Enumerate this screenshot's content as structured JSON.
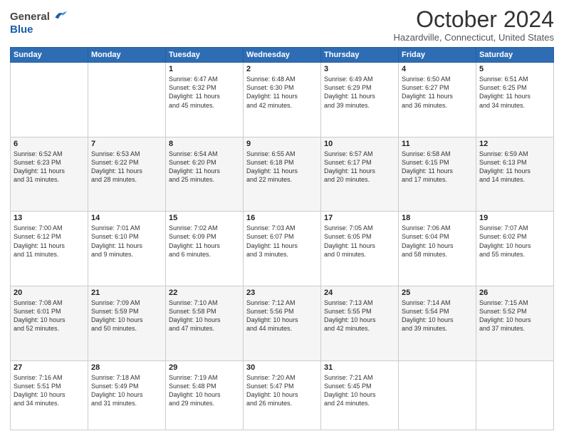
{
  "header": {
    "logo_general": "General",
    "logo_blue": "Blue",
    "title": "October 2024",
    "location": "Hazardville, Connecticut, United States"
  },
  "days_of_week": [
    "Sunday",
    "Monday",
    "Tuesday",
    "Wednesday",
    "Thursday",
    "Friday",
    "Saturday"
  ],
  "rows": [
    [
      {
        "num": "",
        "lines": []
      },
      {
        "num": "",
        "lines": []
      },
      {
        "num": "1",
        "lines": [
          "Sunrise: 6:47 AM",
          "Sunset: 6:32 PM",
          "Daylight: 11 hours",
          "and 45 minutes."
        ]
      },
      {
        "num": "2",
        "lines": [
          "Sunrise: 6:48 AM",
          "Sunset: 6:30 PM",
          "Daylight: 11 hours",
          "and 42 minutes."
        ]
      },
      {
        "num": "3",
        "lines": [
          "Sunrise: 6:49 AM",
          "Sunset: 6:29 PM",
          "Daylight: 11 hours",
          "and 39 minutes."
        ]
      },
      {
        "num": "4",
        "lines": [
          "Sunrise: 6:50 AM",
          "Sunset: 6:27 PM",
          "Daylight: 11 hours",
          "and 36 minutes."
        ]
      },
      {
        "num": "5",
        "lines": [
          "Sunrise: 6:51 AM",
          "Sunset: 6:25 PM",
          "Daylight: 11 hours",
          "and 34 minutes."
        ]
      }
    ],
    [
      {
        "num": "6",
        "lines": [
          "Sunrise: 6:52 AM",
          "Sunset: 6:23 PM",
          "Daylight: 11 hours",
          "and 31 minutes."
        ]
      },
      {
        "num": "7",
        "lines": [
          "Sunrise: 6:53 AM",
          "Sunset: 6:22 PM",
          "Daylight: 11 hours",
          "and 28 minutes."
        ]
      },
      {
        "num": "8",
        "lines": [
          "Sunrise: 6:54 AM",
          "Sunset: 6:20 PM",
          "Daylight: 11 hours",
          "and 25 minutes."
        ]
      },
      {
        "num": "9",
        "lines": [
          "Sunrise: 6:55 AM",
          "Sunset: 6:18 PM",
          "Daylight: 11 hours",
          "and 22 minutes."
        ]
      },
      {
        "num": "10",
        "lines": [
          "Sunrise: 6:57 AM",
          "Sunset: 6:17 PM",
          "Daylight: 11 hours",
          "and 20 minutes."
        ]
      },
      {
        "num": "11",
        "lines": [
          "Sunrise: 6:58 AM",
          "Sunset: 6:15 PM",
          "Daylight: 11 hours",
          "and 17 minutes."
        ]
      },
      {
        "num": "12",
        "lines": [
          "Sunrise: 6:59 AM",
          "Sunset: 6:13 PM",
          "Daylight: 11 hours",
          "and 14 minutes."
        ]
      }
    ],
    [
      {
        "num": "13",
        "lines": [
          "Sunrise: 7:00 AM",
          "Sunset: 6:12 PM",
          "Daylight: 11 hours",
          "and 11 minutes."
        ]
      },
      {
        "num": "14",
        "lines": [
          "Sunrise: 7:01 AM",
          "Sunset: 6:10 PM",
          "Daylight: 11 hours",
          "and 9 minutes."
        ]
      },
      {
        "num": "15",
        "lines": [
          "Sunrise: 7:02 AM",
          "Sunset: 6:09 PM",
          "Daylight: 11 hours",
          "and 6 minutes."
        ]
      },
      {
        "num": "16",
        "lines": [
          "Sunrise: 7:03 AM",
          "Sunset: 6:07 PM",
          "Daylight: 11 hours",
          "and 3 minutes."
        ]
      },
      {
        "num": "17",
        "lines": [
          "Sunrise: 7:05 AM",
          "Sunset: 6:05 PM",
          "Daylight: 11 hours",
          "and 0 minutes."
        ]
      },
      {
        "num": "18",
        "lines": [
          "Sunrise: 7:06 AM",
          "Sunset: 6:04 PM",
          "Daylight: 10 hours",
          "and 58 minutes."
        ]
      },
      {
        "num": "19",
        "lines": [
          "Sunrise: 7:07 AM",
          "Sunset: 6:02 PM",
          "Daylight: 10 hours",
          "and 55 minutes."
        ]
      }
    ],
    [
      {
        "num": "20",
        "lines": [
          "Sunrise: 7:08 AM",
          "Sunset: 6:01 PM",
          "Daylight: 10 hours",
          "and 52 minutes."
        ]
      },
      {
        "num": "21",
        "lines": [
          "Sunrise: 7:09 AM",
          "Sunset: 5:59 PM",
          "Daylight: 10 hours",
          "and 50 minutes."
        ]
      },
      {
        "num": "22",
        "lines": [
          "Sunrise: 7:10 AM",
          "Sunset: 5:58 PM",
          "Daylight: 10 hours",
          "and 47 minutes."
        ]
      },
      {
        "num": "23",
        "lines": [
          "Sunrise: 7:12 AM",
          "Sunset: 5:56 PM",
          "Daylight: 10 hours",
          "and 44 minutes."
        ]
      },
      {
        "num": "24",
        "lines": [
          "Sunrise: 7:13 AM",
          "Sunset: 5:55 PM",
          "Daylight: 10 hours",
          "and 42 minutes."
        ]
      },
      {
        "num": "25",
        "lines": [
          "Sunrise: 7:14 AM",
          "Sunset: 5:54 PM",
          "Daylight: 10 hours",
          "and 39 minutes."
        ]
      },
      {
        "num": "26",
        "lines": [
          "Sunrise: 7:15 AM",
          "Sunset: 5:52 PM",
          "Daylight: 10 hours",
          "and 37 minutes."
        ]
      }
    ],
    [
      {
        "num": "27",
        "lines": [
          "Sunrise: 7:16 AM",
          "Sunset: 5:51 PM",
          "Daylight: 10 hours",
          "and 34 minutes."
        ]
      },
      {
        "num": "28",
        "lines": [
          "Sunrise: 7:18 AM",
          "Sunset: 5:49 PM",
          "Daylight: 10 hours",
          "and 31 minutes."
        ]
      },
      {
        "num": "29",
        "lines": [
          "Sunrise: 7:19 AM",
          "Sunset: 5:48 PM",
          "Daylight: 10 hours",
          "and 29 minutes."
        ]
      },
      {
        "num": "30",
        "lines": [
          "Sunrise: 7:20 AM",
          "Sunset: 5:47 PM",
          "Daylight: 10 hours",
          "and 26 minutes."
        ]
      },
      {
        "num": "31",
        "lines": [
          "Sunrise: 7:21 AM",
          "Sunset: 5:45 PM",
          "Daylight: 10 hours",
          "and 24 minutes."
        ]
      },
      {
        "num": "",
        "lines": []
      },
      {
        "num": "",
        "lines": []
      }
    ]
  ]
}
